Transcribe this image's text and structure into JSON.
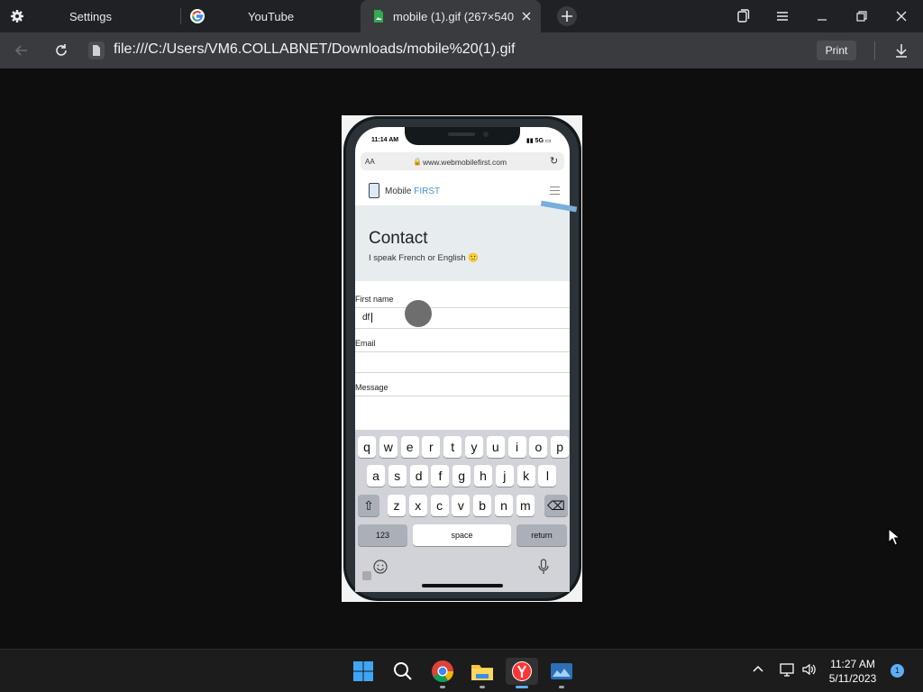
{
  "browser": {
    "tabs": [
      {
        "label": "Settings",
        "icon": "gear-icon"
      },
      {
        "label": "YouTube",
        "icon": "google-icon"
      },
      {
        "label": "mobile (1).gif (267×540",
        "icon": "image-file-icon",
        "active": true
      }
    ],
    "url": "file:///C:/Users/VM6.COLLABNET/Downloads/mobile%20(1).gif",
    "print_label": "Print"
  },
  "phone": {
    "status_time": "11:14 AM",
    "status_network": "5G",
    "address_aa": "AA",
    "address_url": "www.webmobilefirst.com",
    "logo_main": "Mobile",
    "logo_accent": "FIRST",
    "hero_title": "Contact",
    "hero_subtitle": "I speak French or English 🙂",
    "fields": [
      {
        "label": "First name",
        "value": "df"
      },
      {
        "label": "Email",
        "value": ""
      },
      {
        "label": "Message",
        "value": ""
      }
    ],
    "keyboard": {
      "row1": [
        "q",
        "w",
        "e",
        "r",
        "t",
        "y",
        "u",
        "i",
        "o",
        "p"
      ],
      "row2": [
        "a",
        "s",
        "d",
        "f",
        "g",
        "h",
        "j",
        "k",
        "l"
      ],
      "row3": [
        "z",
        "x",
        "c",
        "v",
        "b",
        "n",
        "m"
      ],
      "shift": "⇧",
      "backspace": "⌫",
      "numbers": "123",
      "space": "space",
      "return": "return"
    }
  },
  "taskbar": {
    "apps": [
      "windows-start-icon",
      "search-icon",
      "chrome-icon",
      "file-explorer-icon",
      "yandex-browser-icon",
      "image-viewer-icon"
    ],
    "time": "11:27 AM",
    "date": "5/11/2023",
    "notification_count": "1"
  },
  "colors": {
    "accent": "#5eaef5",
    "brand_blue": "#4a90c8",
    "tab_bg": "#202124",
    "toolbar_bg": "#3a3b3e"
  }
}
